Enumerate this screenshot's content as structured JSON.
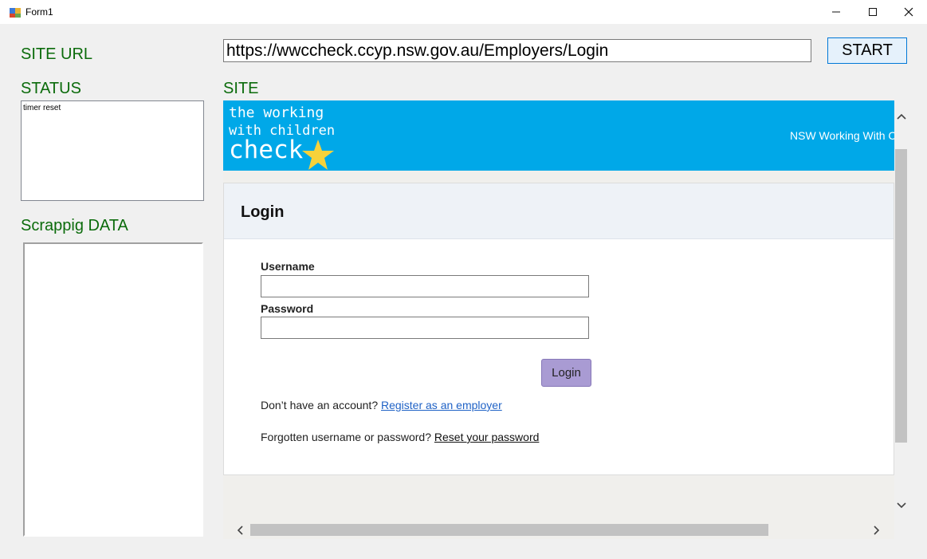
{
  "window": {
    "title": "Form1"
  },
  "labels": {
    "site_url": "SITE URL",
    "status": "STATUS",
    "site": "SITE",
    "scraping_data": "Scrappig DATA"
  },
  "url_input": {
    "value": "https://wwccheck.ccyp.nsw.gov.au/Employers/Login"
  },
  "start_button": {
    "label": "START"
  },
  "status_log": {
    "text": "timer reset"
  },
  "banner": {
    "logo_line1": "the working",
    "logo_line2": "with children",
    "logo_line3": "check",
    "right_text": "NSW Working With C",
    "color": "#00a8e8"
  },
  "login": {
    "title": "Login",
    "username_label": "Username",
    "password_label": "Password",
    "button_label": "Login",
    "no_account_text": "Don’t have an account?",
    "register_link": "Register as an employer",
    "forgot_text": "Forgotten username or password?",
    "reset_link": "Reset your password"
  },
  "colors": {
    "label_green": "#0b6b0b",
    "login_button": "#a99bd3",
    "link_blue": "#1f62c6"
  }
}
